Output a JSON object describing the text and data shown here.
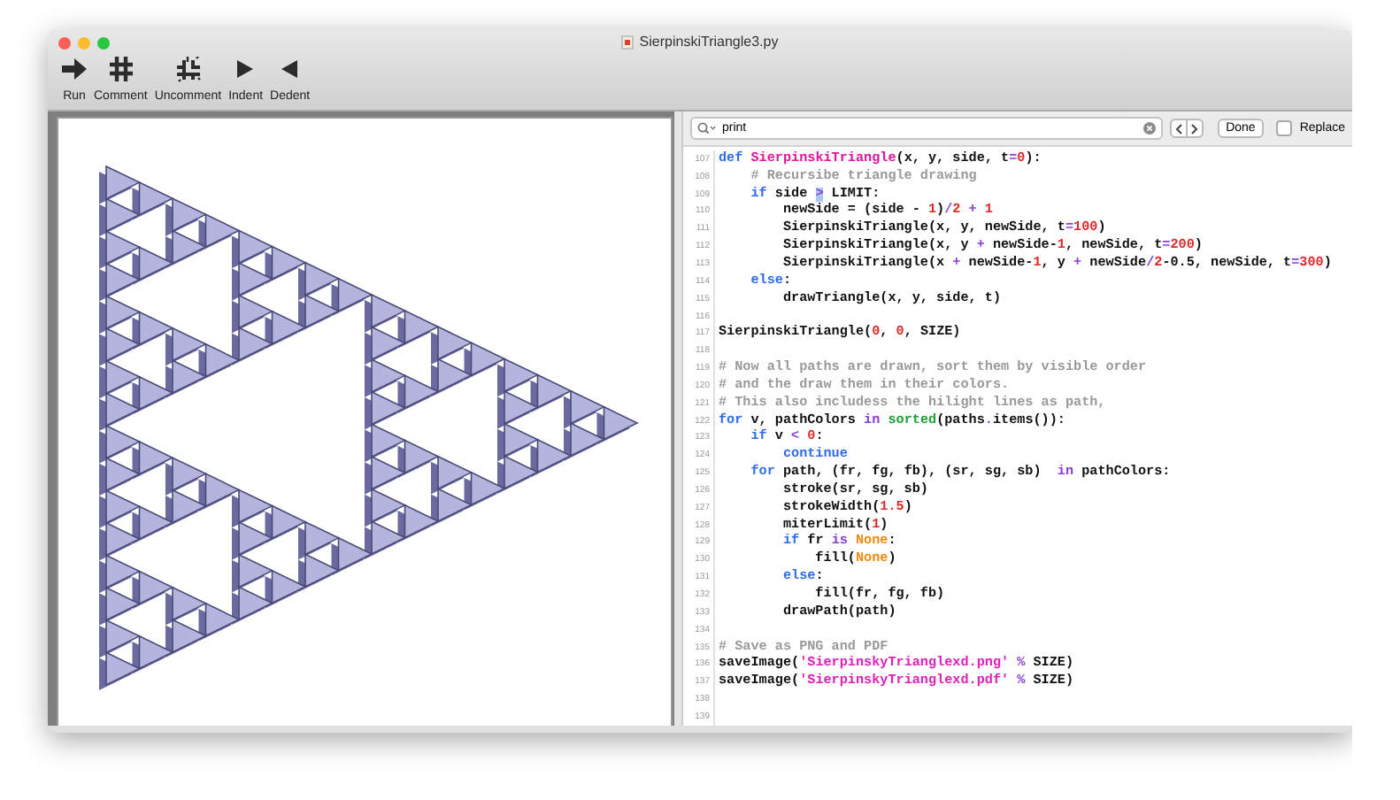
{
  "window": {
    "title": "SierpinskiTriangle3.py"
  },
  "toolbar": [
    {
      "label": "Run",
      "kind": "run"
    },
    {
      "label": "Comment",
      "kind": "comment"
    },
    {
      "label": "Uncomment",
      "kind": "uncomment"
    },
    {
      "label": "Indent",
      "kind": "indent"
    },
    {
      "label": "Dedent",
      "kind": "dedent"
    }
  ],
  "find_bar": {
    "value": "print",
    "done": "Done",
    "replace": {
      "label": "Replace",
      "checked": false
    }
  },
  "editor": {
    "lines": [
      {
        "number": "107",
        "tokens": [
          {
            "kind": "k",
            "text": "def "
          },
          {
            "kind": "f",
            "text": "SierpinskiTriangle"
          },
          {
            "kind": "p",
            "text": "(x, y, side, t"
          },
          {
            "kind": "o",
            "text": "="
          },
          {
            "kind": "n",
            "text": "0"
          },
          {
            "kind": "p",
            "text": "):"
          }
        ]
      },
      {
        "number": "108",
        "tokens": [
          {
            "kind": "c",
            "text": "    # Recursibe triangle drawing"
          }
        ]
      },
      {
        "number": "109",
        "tokens": [
          {
            "kind": "k",
            "text": "    if"
          },
          {
            "kind": "p",
            "text": " side "
          },
          {
            "kind": "h",
            "text": ">"
          },
          {
            "kind": "p",
            "text": " LIMIT:"
          }
        ]
      },
      {
        "number": "110",
        "tokens": [
          {
            "kind": "p",
            "text": "        newSide = (side - "
          },
          {
            "kind": "n",
            "text": "1"
          },
          {
            "kind": "p",
            "text": ")"
          },
          {
            "kind": "o",
            "text": "/"
          },
          {
            "kind": "n",
            "text": "2"
          },
          {
            "kind": "o",
            "text": " + "
          },
          {
            "kind": "n",
            "text": "1"
          }
        ]
      },
      {
        "number": "111",
        "tokens": [
          {
            "kind": "p",
            "text": "        SierpinskiTriangle(x, y, newSide, t"
          },
          {
            "kind": "o",
            "text": "="
          },
          {
            "kind": "n",
            "text": "100"
          },
          {
            "kind": "p",
            "text": ")"
          }
        ]
      },
      {
        "number": "112",
        "tokens": [
          {
            "kind": "p",
            "text": "        SierpinskiTriangle(x, y "
          },
          {
            "kind": "o",
            "text": "+"
          },
          {
            "kind": "p",
            "text": " newSide-"
          },
          {
            "kind": "n",
            "text": "1"
          },
          {
            "kind": "p",
            "text": ", newSide, t"
          },
          {
            "kind": "o",
            "text": "="
          },
          {
            "kind": "n",
            "text": "200"
          },
          {
            "kind": "p",
            "text": ")"
          }
        ]
      },
      {
        "number": "113",
        "tokens": [
          {
            "kind": "p",
            "text": "        SierpinskiTriangle(x "
          },
          {
            "kind": "o",
            "text": "+"
          },
          {
            "kind": "p",
            "text": " newSide-"
          },
          {
            "kind": "n",
            "text": "1"
          },
          {
            "kind": "p",
            "text": ", y "
          },
          {
            "kind": "o",
            "text": "+"
          },
          {
            "kind": "p",
            "text": " newSide"
          },
          {
            "kind": "o",
            "text": "/"
          },
          {
            "kind": "n",
            "text": "2"
          },
          {
            "kind": "p",
            "text": "-0.5, newSide, t"
          },
          {
            "kind": "o",
            "text": "="
          },
          {
            "kind": "n",
            "text": "300"
          },
          {
            "kind": "p",
            "text": ")"
          }
        ]
      },
      {
        "number": "114",
        "tokens": [
          {
            "kind": "k",
            "text": "    else"
          },
          {
            "kind": "p",
            "text": ":"
          }
        ]
      },
      {
        "number": "115",
        "tokens": [
          {
            "kind": "p",
            "text": "        drawTriangle(x, y, side, t)"
          }
        ]
      },
      {
        "number": "116"
      },
      {
        "number": "117",
        "tokens": [
          {
            "kind": "p",
            "text": "SierpinskiTriangle("
          },
          {
            "kind": "n",
            "text": "0"
          },
          {
            "kind": "p",
            "text": ", "
          },
          {
            "kind": "n",
            "text": "0"
          },
          {
            "kind": "p",
            "text": ", SIZE)"
          }
        ]
      },
      {
        "number": "118"
      },
      {
        "number": "119",
        "tokens": [
          {
            "kind": "c",
            "text": "# Now all paths are drawn, sort them by visible order"
          }
        ]
      },
      {
        "number": "120",
        "tokens": [
          {
            "kind": "c",
            "text": "# and the draw them in their colors."
          }
        ]
      },
      {
        "number": "121",
        "tokens": [
          {
            "kind": "c",
            "text": "# This also includess the hilight lines as path,"
          }
        ]
      },
      {
        "number": "122",
        "tokens": [
          {
            "kind": "k",
            "text": "for"
          },
          {
            "kind": "p",
            "text": " v, pathColors "
          },
          {
            "kind": "o",
            "text": "in"
          },
          {
            "kind": "b",
            "text": " sorted"
          },
          {
            "kind": "p",
            "text": "(paths"
          },
          {
            "kind": "o",
            "text": "."
          },
          {
            "kind": "p",
            "text": "items()):"
          }
        ]
      },
      {
        "number": "123",
        "tokens": [
          {
            "kind": "k",
            "text": "    if"
          },
          {
            "kind": "p",
            "text": " v "
          },
          {
            "kind": "o",
            "text": "<"
          },
          {
            "kind": "n",
            "text": " 0"
          },
          {
            "kind": "p",
            "text": ":"
          }
        ]
      },
      {
        "number": "124",
        "tokens": [
          {
            "kind": "k",
            "text": "        continue"
          }
        ]
      },
      {
        "number": "125",
        "tokens": [
          {
            "kind": "k",
            "text": "    for"
          },
          {
            "kind": "p",
            "text": " path, (fr, fg, fb), (sr, sg, sb)  "
          },
          {
            "kind": "o",
            "text": "in"
          },
          {
            "kind": "p",
            "text": " pathColors:"
          }
        ]
      },
      {
        "number": "126",
        "tokens": [
          {
            "kind": "p",
            "text": "        stroke(sr, sg, sb)"
          }
        ]
      },
      {
        "number": "127",
        "tokens": [
          {
            "kind": "p",
            "text": "        strokeWidth("
          },
          {
            "kind": "n",
            "text": "1.5"
          },
          {
            "kind": "p",
            "text": ")"
          }
        ]
      },
      {
        "number": "128",
        "tokens": [
          {
            "kind": "p",
            "text": "        miterLimit("
          },
          {
            "kind": "n",
            "text": "1"
          },
          {
            "kind": "p",
            "text": ")"
          }
        ]
      },
      {
        "number": "129",
        "tokens": [
          {
            "kind": "k",
            "text": "        if"
          },
          {
            "kind": "p",
            "text": " fr "
          },
          {
            "kind": "o",
            "text": "is"
          },
          {
            "kind": "x",
            "text": " None"
          },
          {
            "kind": "p",
            "text": ":"
          }
        ]
      },
      {
        "number": "130",
        "tokens": [
          {
            "kind": "p",
            "text": "            fill("
          },
          {
            "kind": "x",
            "text": "None"
          },
          {
            "kind": "p",
            "text": ")"
          }
        ]
      },
      {
        "number": "131",
        "tokens": [
          {
            "kind": "k",
            "text": "        else"
          },
          {
            "kind": "p",
            "text": ":"
          }
        ]
      },
      {
        "number": "132",
        "tokens": [
          {
            "kind": "p",
            "text": "            fill(fr, fg, fb)"
          }
        ]
      },
      {
        "number": "133",
        "tokens": [
          {
            "kind": "p",
            "text": "        drawPath(path)"
          }
        ]
      },
      {
        "number": "134"
      },
      {
        "number": "135",
        "tokens": [
          {
            "kind": "c",
            "text": "# Save as PNG and PDF"
          }
        ]
      },
      {
        "number": "136",
        "tokens": [
          {
            "kind": "p",
            "text": "saveImage("
          },
          {
            "kind": "s",
            "text": "'SierpinskyTrianglexd.png'"
          },
          {
            "kind": "o",
            "text": " % "
          },
          {
            "kind": "p",
            "text": "SIZE)"
          }
        ]
      },
      {
        "number": "137",
        "tokens": [
          {
            "kind": "p",
            "text": "saveImage("
          },
          {
            "kind": "s",
            "text": "'SierpinskyTrianglexd.pdf'"
          },
          {
            "kind": "o",
            "text": " % "
          },
          {
            "kind": "p",
            "text": "SIZE)"
          }
        ]
      },
      {
        "number": "138"
      },
      {
        "number": "139"
      }
    ]
  }
}
